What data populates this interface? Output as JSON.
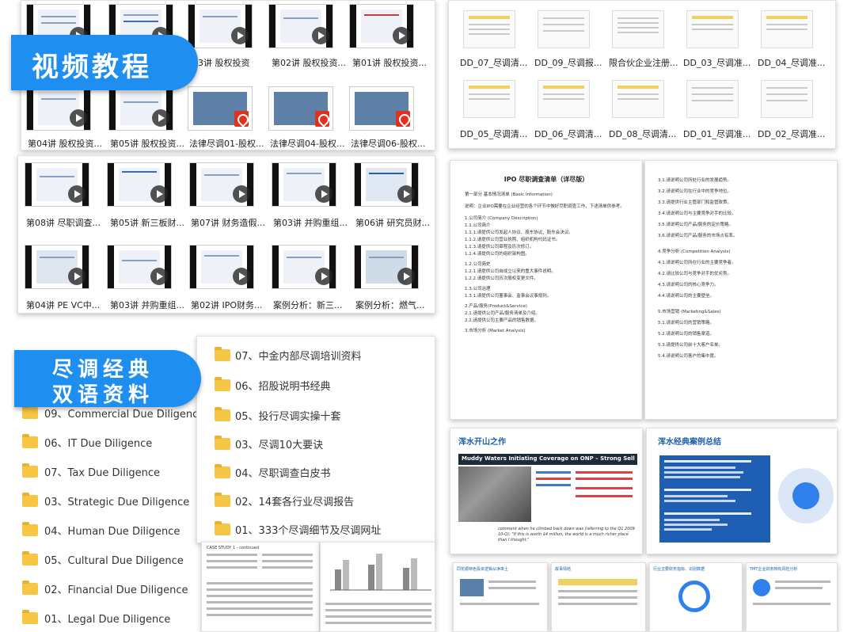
{
  "banners": {
    "video": "视频教程",
    "classic_line1": "尽调经典",
    "classic_line2": "双语资料"
  },
  "videos_top": {
    "row1": [
      "",
      "03讲 股权投资",
      "第02讲 股权投资...",
      "第01讲 股权投资..."
    ],
    "row2": [
      "第04讲 股权投资...",
      "第05讲 股权投资...",
      "法律尽调01-股权...",
      "法律尽调04-股权...",
      "法律尽调06-股权..."
    ]
  },
  "videos_mid": {
    "row1": [
      "第08讲 尽职调查...",
      "第05讲 新三板财...",
      "第07讲 财务造假...",
      "第03讲 并购重组...",
      "第06讲 研究员财..."
    ],
    "row2": [
      "第04讲 PE VC中...",
      "第03讲 并购重组...",
      "第02讲 IPO财务...",
      "案例分析：新三...",
      "案例分析：燃气..."
    ]
  },
  "dd_files": {
    "row1": [
      "DD_07_尽调清...",
      "DD_09_尽调报...",
      "限合伙企业注册...",
      "DD_03_尽调准...",
      "DD_04_尽调准..."
    ],
    "row2": [
      "DD_05_尽调清...",
      "DD_06_尽调清...",
      "DD_08_尽调清...",
      "DD_01_尽调准...",
      "DD_02_尽调准..."
    ]
  },
  "ipo_doc": {
    "title": "IPO 尽职调查清单（详尽版）",
    "section": "第一部分  基本情况清单 (Basic Information)",
    "left_lines": [
      "说明：企业IPO需要在企业经营的各个环节中做好尽职调查工作，下述清单供参考。",
      "1.公司简介 (Company Description)",
      "1.1.公司简介",
      "1.1.1.请提供公司发起人协议、股东协议、股东会决议。",
      "1.1.2.请提供公司营业执照、组织机构代码证书。",
      "1.1.3.请提供公司章程及历次修订。",
      "1.1.4.请提供公司的组织架构图。",
      "1.2.公司简史",
      "1.2.1.请提供公司自成立以来的重大事件说明。",
      "1.2.2.请提供公司历次股权变更文件。",
      "1.3.公司治理",
      "1.3.1.请提供公司董事会、监事会议事规则。",
      "2.产品/服务(Product&Service)",
      "2.1.请提供公司产品/服务清单及介绍。",
      "2.2.请提供公司主要产品的销售数据。",
      "3.市场分析 (Market Analysis)"
    ],
    "right_lines": [
      "3.1.请说明公司所处行业的发展趋势。",
      "3.2.请说明公司在行业中的竞争地位。",
      "3.3.请提供行业主管部门和监管政策。",
      "3.4.请说明公司与主要竞争对手的比较。",
      "3.5.请说明公司产品/服务的定价策略。",
      "3.6.请说明公司产品/服务的市场占有率。",
      "4.竞争分析 (Competition Analysis)",
      "4.1.请说明公司所在行业的主要竞争者。",
      "4.2.请比较公司与竞争对手的优劣势。",
      "4.3.请说明公司的核心竞争力。",
      "4.4.请说明公司的主要壁垒。",
      "5.市场营销 (Marketing&Sales)",
      "5.1.请说明公司的营销策略。",
      "5.2.请说明公司的销售渠道。",
      "5.3.请提供公司前十大客户名单。",
      "5.4.请说明公司客户的集中度。"
    ]
  },
  "folders_cn": [
    "07、中金内部尽调培训资料",
    "06、招股说明书经典",
    "05、投行尽调实操十套",
    "03、尽调10大要诀",
    "04、尽职调查白皮书",
    "02、14套各行业尽调报告",
    "01、333个尽调细节及尽调网址"
  ],
  "folders_en": [
    "09、Commercial Due Diligence",
    "06、IT Due Diligence",
    "07、Tax Due Diligence",
    "03、Strategic Due Diligence",
    "04、Human Due Diligence",
    "05、Cultural Due Diligence",
    "02、Financial Due Diligence",
    "01、Legal Due Diligence"
  ],
  "slides": {
    "left_title": "浑水开山之作",
    "right_title": "浑水经典案例总结",
    "headline": "Muddy Waters Initiating Coverage on ONP – Strong Sell",
    "quote": "comment when he climbed back down was (referring to the Q1 2009 10-Q): \"If this is worth $4 million, the world is a much richer place than I thought.\"",
    "case_study": "CASE STUDY 1 - continued"
  },
  "bottom_slides": [
    "同花顺特色投资逻辑从净率土",
    "故事情结",
    "行业主要财务指标、识别数据",
    "TMT企业财务特有风险分析"
  ]
}
